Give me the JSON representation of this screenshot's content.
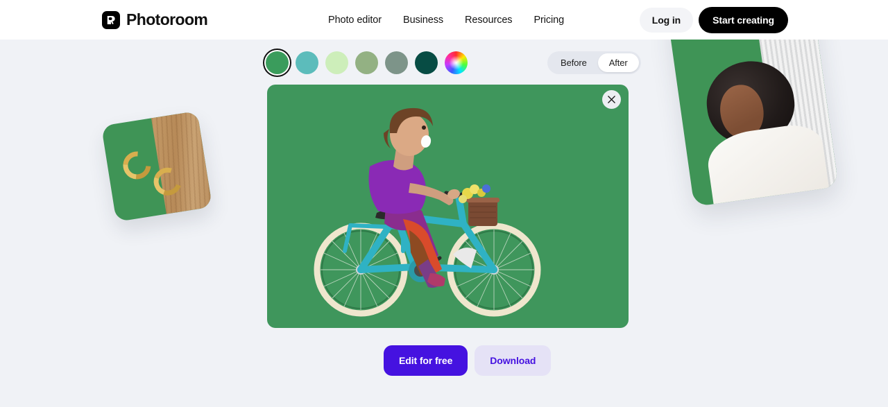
{
  "header": {
    "brand_name": "Photoroom",
    "brand_icon": "photoroom-logo-icon",
    "nav": [
      {
        "label": "Photo editor"
      },
      {
        "label": "Business"
      },
      {
        "label": "Resources"
      },
      {
        "label": "Pricing"
      }
    ],
    "login_label": "Log in",
    "start_label": "Start creating"
  },
  "editor": {
    "swatches": [
      {
        "name": "green",
        "color": "#3a9c5c",
        "selected": true
      },
      {
        "name": "teal",
        "color": "#5cbcbb",
        "selected": false
      },
      {
        "name": "mint",
        "color": "#cdeeba",
        "selected": false
      },
      {
        "name": "sage",
        "color": "#93b183",
        "selected": false
      },
      {
        "name": "gray-green",
        "color": "#7d9489",
        "selected": false
      },
      {
        "name": "dark-teal",
        "color": "#074c44",
        "selected": false
      },
      {
        "name": "color-wheel",
        "color": "rainbow",
        "selected": false
      }
    ],
    "toggle": {
      "before_label": "Before",
      "after_label": "After",
      "selected": "After"
    },
    "close_icon": "close-icon",
    "canvas_background": "#3f965c",
    "subject": "woman riding a teal bicycle with flower basket"
  },
  "actions": {
    "edit_label": "Edit for free",
    "download_label": "Download",
    "edit_color": "#4512e0",
    "download_bg": "#e5e2f6"
  },
  "decorations": {
    "left_card": "gold hoop earrings on green and wood background",
    "right_card": "portrait on green and striped background"
  },
  "theme": {
    "page_background": "#f0f2f6",
    "header_background": "#ffffff",
    "accent": "#4512e0"
  }
}
